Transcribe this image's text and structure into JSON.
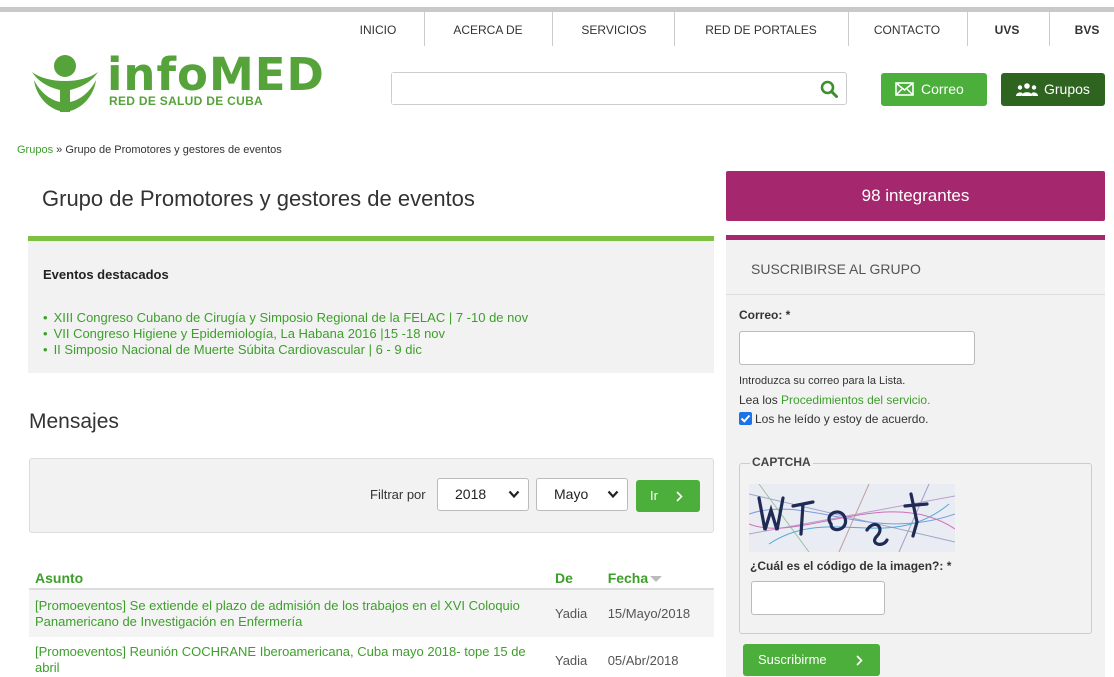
{
  "topnav": {
    "items": [
      "INICIO",
      "ACERCA DE",
      "SERVICIOS",
      "RED DE PORTALES",
      "CONTACTO",
      "UVS",
      "BVS"
    ]
  },
  "logo": {
    "brand": "infoMED",
    "tagline": "RED DE SALUD DE CUBA"
  },
  "header": {
    "search_placeholder": "",
    "correo_label": "Correo",
    "grupos_label": "Grupos"
  },
  "breadcrumb": {
    "link": "Grupos",
    "separator": "»",
    "current": "Grupo de Promotores y gestores de eventos"
  },
  "group": {
    "title": "Grupo de Promotores y gestores de eventos",
    "members": "98 integrantes"
  },
  "featured": {
    "heading": "Eventos destacados",
    "items": [
      "XIII Congreso Cubano de Cirugía y Simposio Regional de la FELAC | 7 -10 de nov",
      "VII Congreso Higiene  y Epidemiología, La Habana 2016 |15 -18 nov",
      "II Simposio Nacional de Muerte Súbita Cardiovascular | 6 - 9 dic"
    ]
  },
  "messages": {
    "title": "Mensajes",
    "filter_label": "Filtrar por",
    "year": "2018",
    "month": "Mayo",
    "go_label": "Ir",
    "columns": {
      "subject": "Asunto",
      "from": "De",
      "date": "Fecha"
    },
    "rows": [
      {
        "subject": "[Promoeventos] Se extiende el plazo de admisión de los trabajos en el XVI Coloquio Panamericano de Investigación en Enfermería",
        "from": "Yadia",
        "date": "15/Mayo/2018"
      },
      {
        "subject": "[Promoeventos] Reunión COCHRANE Iberoamericana, Cuba mayo 2018- tope 15 de abril",
        "from": "Yadia",
        "date": "05/Abr/2018"
      }
    ]
  },
  "subscribe": {
    "heading": "SUSCRIBIRSE AL GRUPO",
    "email_label": "Correo: *",
    "hint": "Introduzca su correo para la Lista.",
    "read_prefix": "Lea los",
    "read_link": "Procedimientos del servicio.",
    "agree_label": "Los he leído y estoy de acuerdo.",
    "agree_checked": true,
    "captcha_legend": "CAPTCHA",
    "captcha_question": "¿Cuál es el código de la imagen?: *",
    "submit_label": "Suscribirme"
  },
  "colors": {
    "brand_green": "#55a33a",
    "button_green": "#4caf3b",
    "dark_green": "#2e6420",
    "magenta": "#a5286e"
  }
}
